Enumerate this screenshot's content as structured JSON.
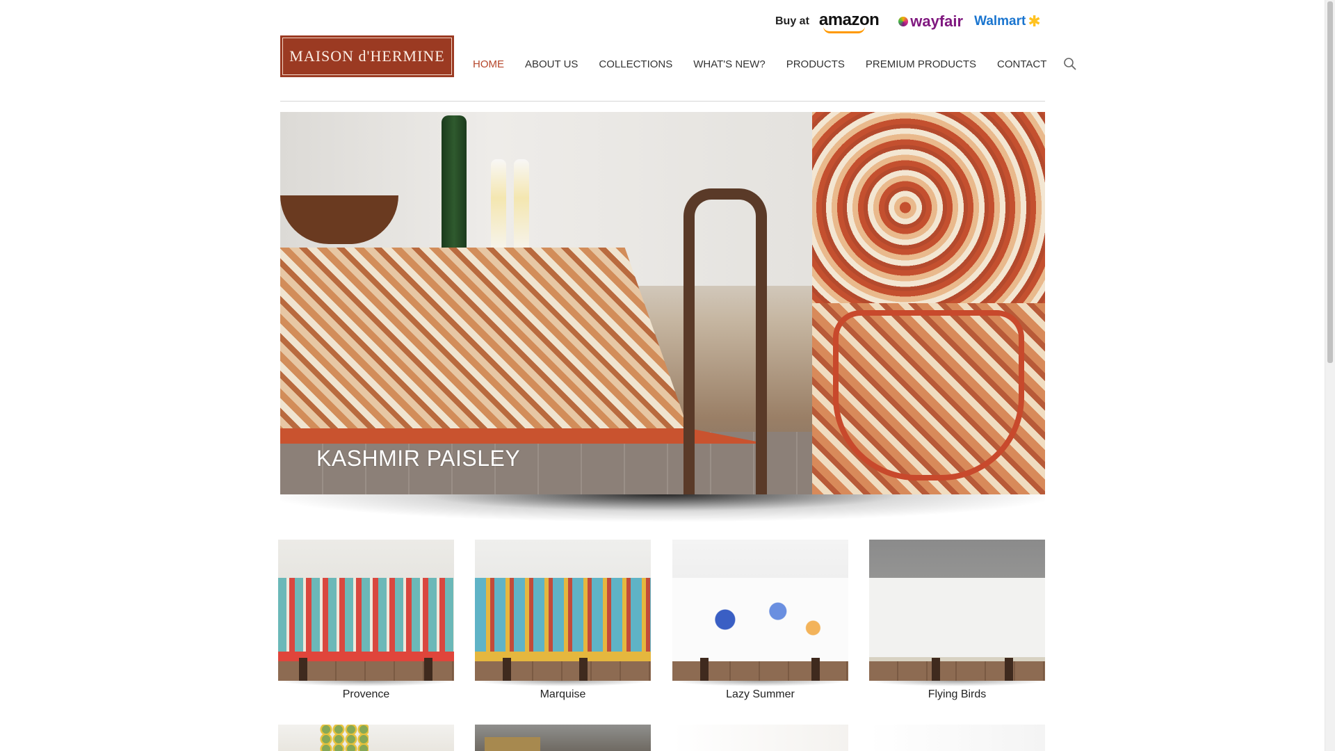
{
  "header": {
    "buy_at_label": "Buy at",
    "retailers": [
      {
        "name": "amazon",
        "label": "amazon"
      },
      {
        "name": "wayfair",
        "label": "wayfair"
      },
      {
        "name": "walmart",
        "label": "Walmart"
      }
    ],
    "logo_text": "MAISON d'HERMINE",
    "brand_color": "#9b3a22",
    "accent_color": "#b5462a"
  },
  "nav": {
    "items": [
      {
        "label": "HOME",
        "active": true
      },
      {
        "label": "ABOUT US",
        "active": false
      },
      {
        "label": "COLLECTIONS",
        "active": false
      },
      {
        "label": "WHAT'S NEW?",
        "active": false
      },
      {
        "label": "PRODUCTS",
        "active": false
      },
      {
        "label": "PREMIUM PRODUCTS",
        "active": false
      },
      {
        "label": "CONTACT",
        "active": false
      }
    ],
    "search_icon": "search-icon"
  },
  "hero": {
    "caption": "KASHMIR PAISLEY"
  },
  "products": [
    {
      "name": "Provence"
    },
    {
      "name": "Marquise"
    },
    {
      "name": "Lazy Summer"
    },
    {
      "name": "Flying Birds"
    }
  ]
}
